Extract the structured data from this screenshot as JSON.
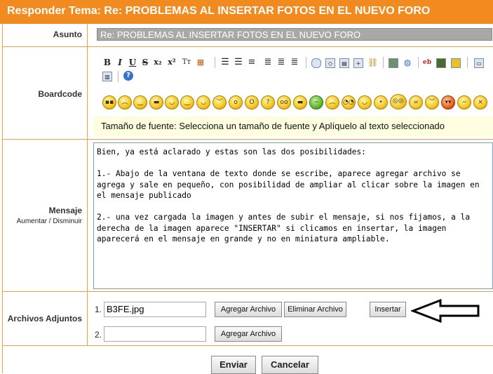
{
  "title": "Responder Tema: Re: PROBLEMAS AL INSERTAR FOTOS EN EL NUEVO FORO",
  "colors": {
    "accent": "#f18a1f",
    "hint_bg": "#fffde0",
    "border": "#f0a040"
  },
  "subject": {
    "label": "Asunto",
    "value": "Re: PROBLEMAS  AL INSERTAR FOTOS EN EL NUEVO FORO"
  },
  "boardcode": {
    "label": "Boardcode",
    "toolbar_icons": [
      "bold-icon",
      "italic-icon",
      "underline-icon",
      "strikethrough-icon",
      "subscript-icon",
      "superscript-icon",
      "teletype-icon",
      "table-icon",
      "bullet-list-icon",
      "numbered-list-icon",
      "list-icon",
      "align-left-icon",
      "align-center-icon",
      "align-right-icon",
      "quote-icon",
      "code-icon",
      "html-icon",
      "insert-image-icon",
      "insert-link-icon",
      "photo-icon",
      "globe-icon",
      "ebay-icon",
      "video-icon",
      "media-icon",
      "hr-icon",
      "table-grid-icon",
      "help-icon"
    ],
    "smileys": 21,
    "hint": "Tamaño de fuente: Selecciona un tamaño de fuente y Aplíquelo al texto seleccionado"
  },
  "message": {
    "label": "Mensaje",
    "increase": "Aumentar",
    "separator": "/",
    "decrease": "Disminuir",
    "text": "Bien, ya está aclarado y estas son las dos posibilidades:\n\n1.- Abajo de la ventana de texto donde se escribe, aparece agregar archivo se agrega y sale en pequeño, con posibilidad de ampliar al clicar sobre la imagen en el mensaje publicado\n\n2.- una vez cargada la imagen y antes de subir el mensaje, si nos fijamos, a la derecha de la imagen aparece \"INSERTAR\" si clicamos en insertar, la imagen aparecerá en el mensaje en grande y no en miniatura ampliable."
  },
  "attachments": {
    "label": "Archivos Adjuntos",
    "rows": [
      {
        "num": "1.",
        "file": "B3FE.jpg",
        "add": "Agregar Archivo",
        "remove": "Eliminar Archivo",
        "insert": "Insertar"
      },
      {
        "num": "2.",
        "file": "",
        "add": "Agregar Archivo"
      }
    ]
  },
  "actions": {
    "submit": "Enviar",
    "cancel": "Cancelar"
  }
}
